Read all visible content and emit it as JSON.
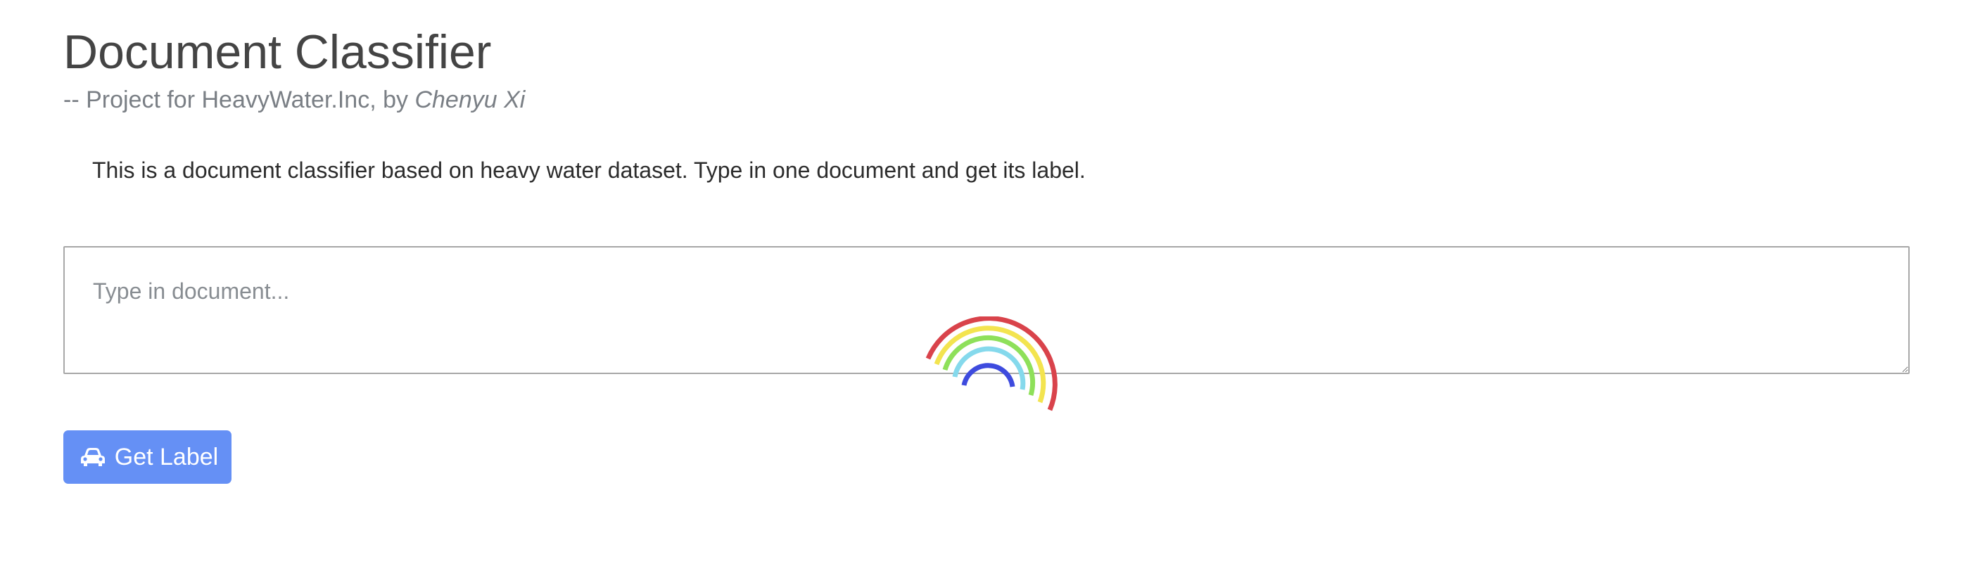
{
  "header": {
    "title": "Document Classifier",
    "subtitle_prefix": "-- Project for HeavyWater.Inc, by ",
    "author": "Chenyu Xi"
  },
  "description": "This is a document classifier based on heavy water dataset. Type in one document and get its label.",
  "document_input": {
    "placeholder": "Type in document...",
    "value": ""
  },
  "actions": {
    "get_label_button": "Get Label",
    "button_icon": "car-icon"
  },
  "loading_indicator": {
    "icon": "rainbow-spinner-icon",
    "colors": [
      "#d9434b",
      "#f3e44f",
      "#8ee05a",
      "#85d9ec",
      "#3e4bde"
    ]
  },
  "colors": {
    "accent": "#6590f5",
    "title": "#444444",
    "subtitle": "#7a7f85",
    "text": "#2c2c2c"
  }
}
